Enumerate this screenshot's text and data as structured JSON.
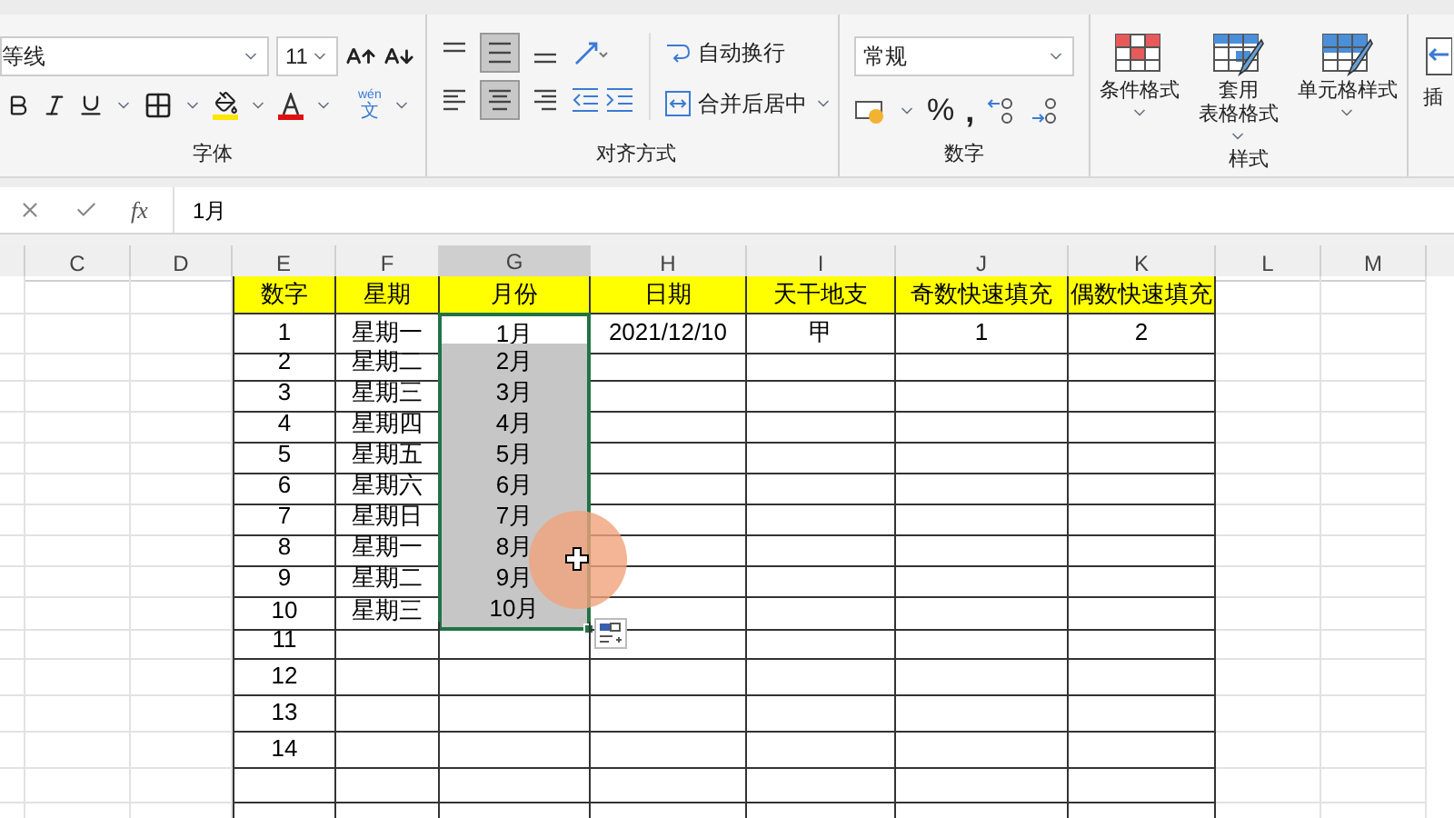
{
  "ribbon": {
    "font": {
      "name": "等线",
      "size": "11",
      "group_label": "字体",
      "phonetic_top": "wén",
      "phonetic_bottom": "文"
    },
    "alignment": {
      "vertical": [
        {
          "kind": "top",
          "selected": false
        },
        {
          "kind": "middle",
          "selected": true
        },
        {
          "kind": "bottom",
          "selected": false
        }
      ],
      "horizontal": [
        {
          "kind": "left",
          "selected": false
        },
        {
          "kind": "center",
          "selected": true
        },
        {
          "kind": "right",
          "selected": false
        }
      ],
      "wrap_text": "自动换行",
      "merge_center": "合并后居中",
      "group_label": "对齐方式"
    },
    "number": {
      "format": "常规",
      "percent": "%",
      "comma": ",",
      "group_label": "数字"
    },
    "styles": {
      "items": [
        {
          "kind": "conditional",
          "label": [
            "条件格式"
          ]
        },
        {
          "kind": "table",
          "label": [
            "套用",
            "表格格式"
          ]
        },
        {
          "kind": "cell",
          "label": [
            "单元格样式"
          ]
        }
      ],
      "group_label": "样式"
    },
    "insert": {
      "label": "插"
    }
  },
  "formula_bar": {
    "fx": "fx",
    "value": "1月"
  },
  "sheet": {
    "columns": [
      {
        "label": "C",
        "selected": false
      },
      {
        "label": "D",
        "selected": false
      },
      {
        "label": "E",
        "selected": false
      },
      {
        "label": "F",
        "selected": false
      },
      {
        "label": "G",
        "selected": true
      },
      {
        "label": "H",
        "selected": false
      },
      {
        "label": "I",
        "selected": false
      },
      {
        "label": "J",
        "selected": false
      },
      {
        "label": "K",
        "selected": false
      },
      {
        "label": "L",
        "selected": false
      },
      {
        "label": "M",
        "selected": false
      }
    ],
    "header": [
      {
        "kind": "blank"
      },
      {
        "kind": "blank"
      },
      {
        "kind": "title",
        "text": "数字"
      },
      {
        "kind": "title",
        "text": "星期"
      },
      {
        "kind": "title",
        "text": "月份"
      },
      {
        "kind": "title",
        "text": "日期"
      },
      {
        "kind": "title",
        "text": "天干地支"
      },
      {
        "kind": "title",
        "text": "奇数快速填充"
      },
      {
        "kind": "title",
        "text": "偶数快速填充"
      },
      {
        "kind": "blank"
      },
      {
        "kind": "blank"
      }
    ],
    "rows": [
      {
        "cells": [
          {
            "selected": false,
            "active": false
          },
          {
            "selected": false,
            "active": false
          },
          {
            "text": "1",
            "selected": false,
            "active": false
          },
          {
            "text": "星期一",
            "selected": false,
            "active": false
          },
          {
            "text": "1月",
            "selected": true,
            "active": true
          },
          {
            "text": "2021/12/10",
            "selected": false,
            "active": false
          },
          {
            "text": "甲",
            "selected": false,
            "active": false
          },
          {
            "text": "1",
            "selected": false,
            "active": false
          },
          {
            "text": "2",
            "selected": false,
            "active": false
          },
          {
            "selected": false,
            "active": false
          },
          {
            "selected": false,
            "active": false
          }
        ]
      },
      {
        "cells": [
          {
            "selected": false,
            "active": false
          },
          {
            "selected": false,
            "active": false
          },
          {
            "text": "2",
            "selected": false,
            "active": false
          },
          {
            "text": "星期二",
            "selected": false,
            "active": false
          },
          {
            "text": "2月",
            "selected": true,
            "active": false
          },
          {
            "selected": false,
            "active": false
          },
          {
            "selected": false,
            "active": false
          },
          {
            "selected": false,
            "active": false
          },
          {
            "selected": false,
            "active": false
          },
          {
            "selected": false,
            "active": false
          },
          {
            "selected": false,
            "active": false
          }
        ]
      },
      {
        "cells": [
          {
            "selected": false,
            "active": false
          },
          {
            "selected": false,
            "active": false
          },
          {
            "text": "3",
            "selected": false,
            "active": false
          },
          {
            "text": "星期三",
            "selected": false,
            "active": false
          },
          {
            "text": "3月",
            "selected": true,
            "active": false
          },
          {
            "selected": false,
            "active": false
          },
          {
            "selected": false,
            "active": false
          },
          {
            "selected": false,
            "active": false
          },
          {
            "selected": false,
            "active": false
          },
          {
            "selected": false,
            "active": false
          },
          {
            "selected": false,
            "active": false
          }
        ]
      },
      {
        "cells": [
          {
            "selected": false,
            "active": false
          },
          {
            "selected": false,
            "active": false
          },
          {
            "text": "4",
            "selected": false,
            "active": false
          },
          {
            "text": "星期四",
            "selected": false,
            "active": false
          },
          {
            "text": "4月",
            "selected": true,
            "active": false
          },
          {
            "selected": false,
            "active": false
          },
          {
            "selected": false,
            "active": false
          },
          {
            "selected": false,
            "active": false
          },
          {
            "selected": false,
            "active": false
          },
          {
            "selected": false,
            "active": false
          },
          {
            "selected": false,
            "active": false
          }
        ]
      },
      {
        "cells": [
          {
            "selected": false,
            "active": false
          },
          {
            "selected": false,
            "active": false
          },
          {
            "text": "5",
            "selected": false,
            "active": false
          },
          {
            "text": "星期五",
            "selected": false,
            "active": false
          },
          {
            "text": "5月",
            "selected": true,
            "active": false
          },
          {
            "selected": false,
            "active": false
          },
          {
            "selected": false,
            "active": false
          },
          {
            "selected": false,
            "active": false
          },
          {
            "selected": false,
            "active": false
          },
          {
            "selected": false,
            "active": false
          },
          {
            "selected": false,
            "active": false
          }
        ]
      },
      {
        "cells": [
          {
            "selected": false,
            "active": false
          },
          {
            "selected": false,
            "active": false
          },
          {
            "text": "6",
            "selected": false,
            "active": false
          },
          {
            "text": "星期六",
            "selected": false,
            "active": false
          },
          {
            "text": "6月",
            "selected": true,
            "active": false
          },
          {
            "selected": false,
            "active": false
          },
          {
            "selected": false,
            "active": false
          },
          {
            "selected": false,
            "active": false
          },
          {
            "selected": false,
            "active": false
          },
          {
            "selected": false,
            "active": false
          },
          {
            "selected": false,
            "active": false
          }
        ]
      },
      {
        "cells": [
          {
            "selected": false,
            "active": false
          },
          {
            "selected": false,
            "active": false
          },
          {
            "text": "7",
            "selected": false,
            "active": false
          },
          {
            "text": "星期日",
            "selected": false,
            "active": false
          },
          {
            "text": "7月",
            "selected": true,
            "active": false
          },
          {
            "selected": false,
            "active": false
          },
          {
            "selected": false,
            "active": false
          },
          {
            "selected": false,
            "active": false
          },
          {
            "selected": false,
            "active": false
          },
          {
            "selected": false,
            "active": false
          },
          {
            "selected": false,
            "active": false
          }
        ]
      },
      {
        "cells": [
          {
            "selected": false,
            "active": false
          },
          {
            "selected": false,
            "active": false
          },
          {
            "text": "8",
            "selected": false,
            "active": false
          },
          {
            "text": "星期一",
            "selected": false,
            "active": false
          },
          {
            "text": "8月",
            "selected": true,
            "active": false
          },
          {
            "selected": false,
            "active": false
          },
          {
            "selected": false,
            "active": false
          },
          {
            "selected": false,
            "active": false
          },
          {
            "selected": false,
            "active": false
          },
          {
            "selected": false,
            "active": false
          },
          {
            "selected": false,
            "active": false
          }
        ]
      },
      {
        "cells": [
          {
            "selected": false,
            "active": false
          },
          {
            "selected": false,
            "active": false
          },
          {
            "text": "9",
            "selected": false,
            "active": false
          },
          {
            "text": "星期二",
            "selected": false,
            "active": false
          },
          {
            "text": "9月",
            "selected": true,
            "active": false
          },
          {
            "selected": false,
            "active": false
          },
          {
            "selected": false,
            "active": false
          },
          {
            "selected": false,
            "active": false
          },
          {
            "selected": false,
            "active": false
          },
          {
            "selected": false,
            "active": false
          },
          {
            "selected": false,
            "active": false
          }
        ]
      },
      {
        "cells": [
          {
            "selected": false,
            "active": false
          },
          {
            "selected": false,
            "active": false
          },
          {
            "text": "10",
            "selected": false,
            "active": false
          },
          {
            "text": "星期三",
            "selected": false,
            "active": false
          },
          {
            "text": "10月",
            "selected": true,
            "active": false
          },
          {
            "selected": false,
            "active": false
          },
          {
            "selected": false,
            "active": false
          },
          {
            "selected": false,
            "active": false
          },
          {
            "selected": false,
            "active": false
          },
          {
            "selected": false,
            "active": false
          },
          {
            "selected": false,
            "active": false
          }
        ]
      },
      {
        "cells": [
          {
            "selected": false,
            "active": false
          },
          {
            "selected": false,
            "active": false
          },
          {
            "text": "11",
            "selected": false,
            "active": false
          },
          {
            "selected": false,
            "active": false
          },
          {
            "selected": false,
            "active": false
          },
          {
            "selected": false,
            "active": false
          },
          {
            "selected": false,
            "active": false
          },
          {
            "selected": false,
            "active": false
          },
          {
            "selected": false,
            "active": false
          },
          {
            "selected": false,
            "active": false
          },
          {
            "selected": false,
            "active": false
          }
        ]
      },
      {
        "cells": [
          {
            "selected": false,
            "active": false
          },
          {
            "selected": false,
            "active": false
          },
          {
            "text": "12",
            "selected": false,
            "active": false
          },
          {
            "selected": false,
            "active": false
          },
          {
            "selected": false,
            "active": false
          },
          {
            "selected": false,
            "active": false
          },
          {
            "selected": false,
            "active": false
          },
          {
            "selected": false,
            "active": false
          },
          {
            "selected": false,
            "active": false
          },
          {
            "selected": false,
            "active": false
          },
          {
            "selected": false,
            "active": false
          }
        ]
      },
      {
        "cells": [
          {
            "selected": false,
            "active": false
          },
          {
            "selected": false,
            "active": false
          },
          {
            "text": "13",
            "selected": false,
            "active": false
          },
          {
            "selected": false,
            "active": false
          },
          {
            "selected": false,
            "active": false
          },
          {
            "selected": false,
            "active": false
          },
          {
            "selected": false,
            "active": false
          },
          {
            "selected": false,
            "active": false
          },
          {
            "selected": false,
            "active": false
          },
          {
            "selected": false,
            "active": false
          },
          {
            "selected": false,
            "active": false
          }
        ]
      },
      {
        "cells": [
          {
            "selected": false,
            "active": false
          },
          {
            "selected": false,
            "active": false
          },
          {
            "text": "14",
            "selected": false,
            "active": false
          },
          {
            "selected": false,
            "active": false
          },
          {
            "selected": false,
            "active": false
          },
          {
            "selected": false,
            "active": false
          },
          {
            "selected": false,
            "active": false
          },
          {
            "selected": false,
            "active": false
          },
          {
            "selected": false,
            "active": false
          },
          {
            "selected": false,
            "active": false
          },
          {
            "selected": false,
            "active": false
          }
        ]
      }
    ]
  }
}
